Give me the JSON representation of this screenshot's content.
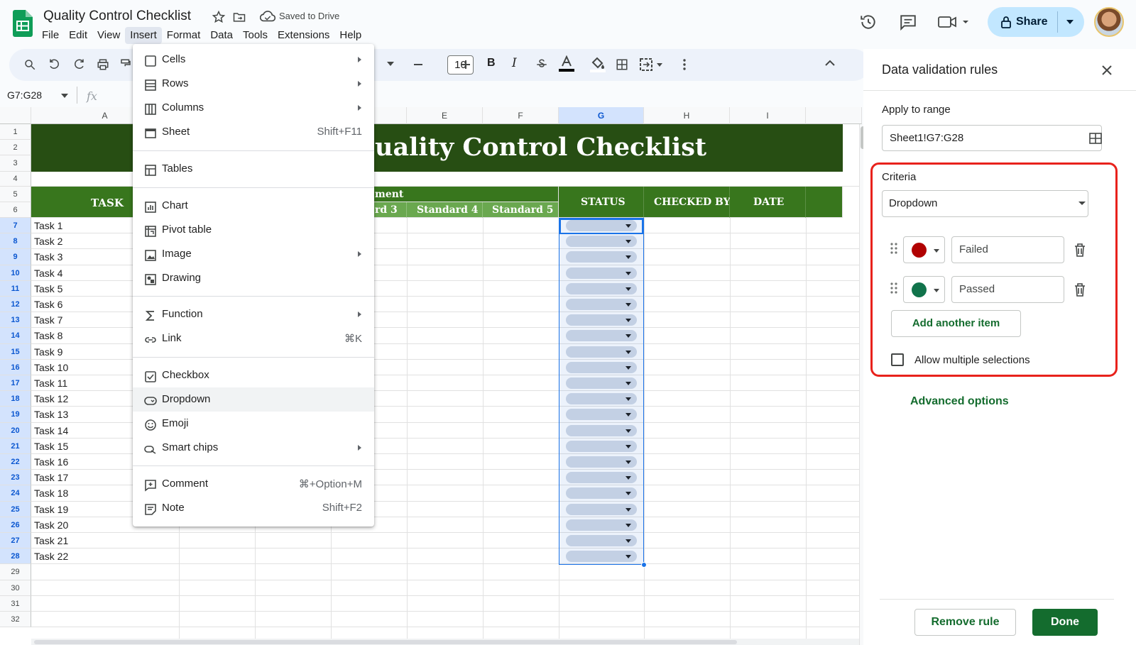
{
  "app": {
    "doc_title": "Quality Control Checklist",
    "save_status": "Saved to Drive"
  },
  "menubar": [
    "File",
    "Edit",
    "View",
    "Insert",
    "Format",
    "Data",
    "Tools",
    "Extensions",
    "Help"
  ],
  "toolbar": {
    "font_size": "10"
  },
  "formula_bar": {
    "name_box": "G7:G28",
    "fx_label": "fx"
  },
  "share": {
    "label": "Share"
  },
  "columns": [
    "A",
    "E",
    "F",
    "G",
    "H",
    "I"
  ],
  "rows": [
    "1",
    "2",
    "3",
    "4",
    "5",
    "6",
    "7",
    "8",
    "9",
    "10",
    "11",
    "12",
    "13",
    "14",
    "15",
    "16",
    "17",
    "18",
    "19",
    "20",
    "21",
    "22",
    "23",
    "24",
    "25",
    "26",
    "27",
    "28",
    "29",
    "30",
    "31",
    "32"
  ],
  "sheet": {
    "banner_title": "uality Control Checklist",
    "task_header": "TASK",
    "group_header": "ment",
    "standards": [
      "rd 3",
      "Standard 4",
      "Standard 5"
    ],
    "status_header": "STATUS",
    "checked_by_header": "CHECKED BY",
    "date_header": "DATE",
    "tasks": [
      "Task 1",
      "Task 2",
      "Task 3",
      "Task 4",
      "Task 5",
      "Task 6",
      "Task 7",
      "Task 8",
      "Task 9",
      "Task 10",
      "Task 11",
      "Task 12",
      "Task 13",
      "Task 14",
      "Task 15",
      "Task 16",
      "Task 17",
      "Task 18",
      "Task 19",
      "Task 20",
      "Task 21",
      "Task 22"
    ]
  },
  "insert_menu": {
    "items": [
      {
        "label": "Cells",
        "shortcut": "",
        "submenu": true,
        "icon": "square-icon"
      },
      {
        "label": "Rows",
        "shortcut": "",
        "submenu": true,
        "icon": "rows-icon"
      },
      {
        "label": "Columns",
        "shortcut": "",
        "submenu": true,
        "icon": "columns-icon"
      },
      {
        "label": "Sheet",
        "shortcut": "Shift+F11",
        "submenu": false,
        "icon": "sheet-icon"
      },
      {
        "label": "Tables",
        "shortcut": "",
        "submenu": false,
        "icon": "table-icon"
      },
      {
        "label": "Chart",
        "shortcut": "",
        "submenu": false,
        "icon": "chart-icon"
      },
      {
        "label": "Pivot table",
        "shortcut": "",
        "submenu": false,
        "icon": "pivot-table-icon"
      },
      {
        "label": "Image",
        "shortcut": "",
        "submenu": true,
        "icon": "image-icon"
      },
      {
        "label": "Drawing",
        "shortcut": "",
        "submenu": false,
        "icon": "drawing-icon"
      },
      {
        "label": "Function",
        "shortcut": "",
        "submenu": true,
        "icon": "sigma-icon"
      },
      {
        "label": "Link",
        "shortcut": "⌘K",
        "submenu": false,
        "icon": "link-icon"
      },
      {
        "label": "Checkbox",
        "shortcut": "",
        "submenu": false,
        "icon": "checkbox-icon"
      },
      {
        "label": "Dropdown",
        "shortcut": "",
        "submenu": false,
        "icon": "dropdown-icon"
      },
      {
        "label": "Emoji",
        "shortcut": "",
        "submenu": false,
        "icon": "emoji-icon"
      },
      {
        "label": "Smart chips",
        "shortcut": "",
        "submenu": true,
        "icon": "smart-chips-icon"
      },
      {
        "label": "Comment",
        "shortcut": "⌘+Option+M",
        "submenu": false,
        "icon": "comment-add-icon"
      },
      {
        "label": "Note",
        "shortcut": "Shift+F2",
        "submenu": false,
        "icon": "note-icon"
      }
    ]
  },
  "panel": {
    "title": "Data validation rules",
    "apply_label": "Apply to range",
    "range": "Sheet1!G7:G28",
    "criteria_label": "Criteria",
    "criteria_value": "Dropdown",
    "items": [
      {
        "label": "Failed",
        "color": "#b10202"
      },
      {
        "label": "Passed",
        "color": "#11734b"
      }
    ],
    "add_item": "Add another item",
    "allow_multiple": "Allow multiple selections",
    "advanced": "Advanced options",
    "remove": "Remove rule",
    "done": "Done"
  }
}
